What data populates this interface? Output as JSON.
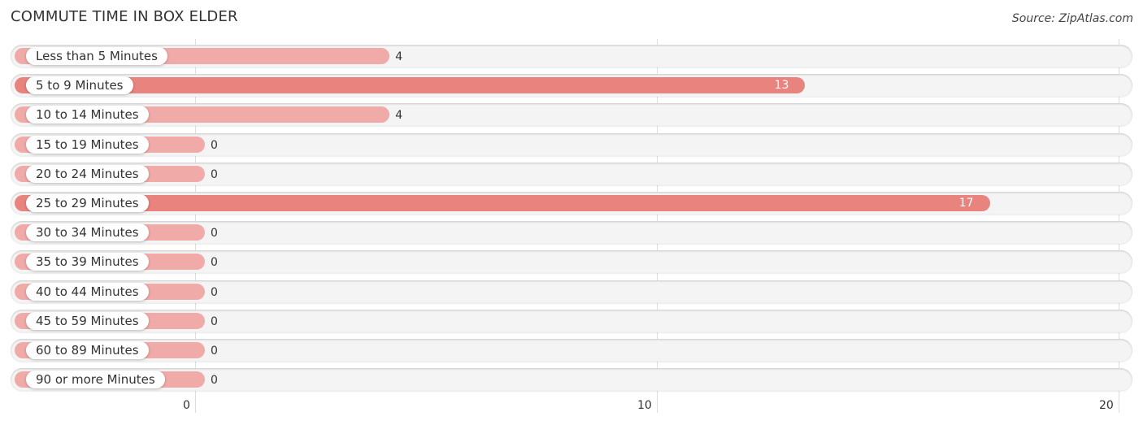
{
  "header": {
    "title": "COMMUTE TIME IN BOX ELDER",
    "source": "Source: ZipAtlas.com"
  },
  "colors": {
    "bar_normal": "#f0aaa8",
    "bar_highlight": "#e8837e",
    "track": "#f4f4f4"
  },
  "chart_data": {
    "type": "bar",
    "orientation": "horizontal",
    "title": "COMMUTE TIME IN BOX ELDER",
    "xlabel": "",
    "ylabel": "",
    "xlim": [
      0,
      20
    ],
    "ticks": [
      0,
      10,
      20
    ],
    "tick_labels": [
      "0",
      "10",
      "20"
    ],
    "grid": true,
    "categories": [
      "Less than 5 Minutes",
      "5 to 9 Minutes",
      "10 to 14 Minutes",
      "15 to 19 Minutes",
      "20 to 24 Minutes",
      "25 to 29 Minutes",
      "30 to 34 Minutes",
      "35 to 39 Minutes",
      "40 to 44 Minutes",
      "45 to 59 Minutes",
      "60 to 89 Minutes",
      "90 or more Minutes"
    ],
    "values": [
      4,
      13,
      4,
      0,
      0,
      17,
      0,
      0,
      0,
      0,
      0,
      0
    ],
    "value_labels": [
      "4",
      "13",
      "4",
      "0",
      "0",
      "17",
      "0",
      "0",
      "0",
      "0",
      "0",
      "0"
    ]
  }
}
